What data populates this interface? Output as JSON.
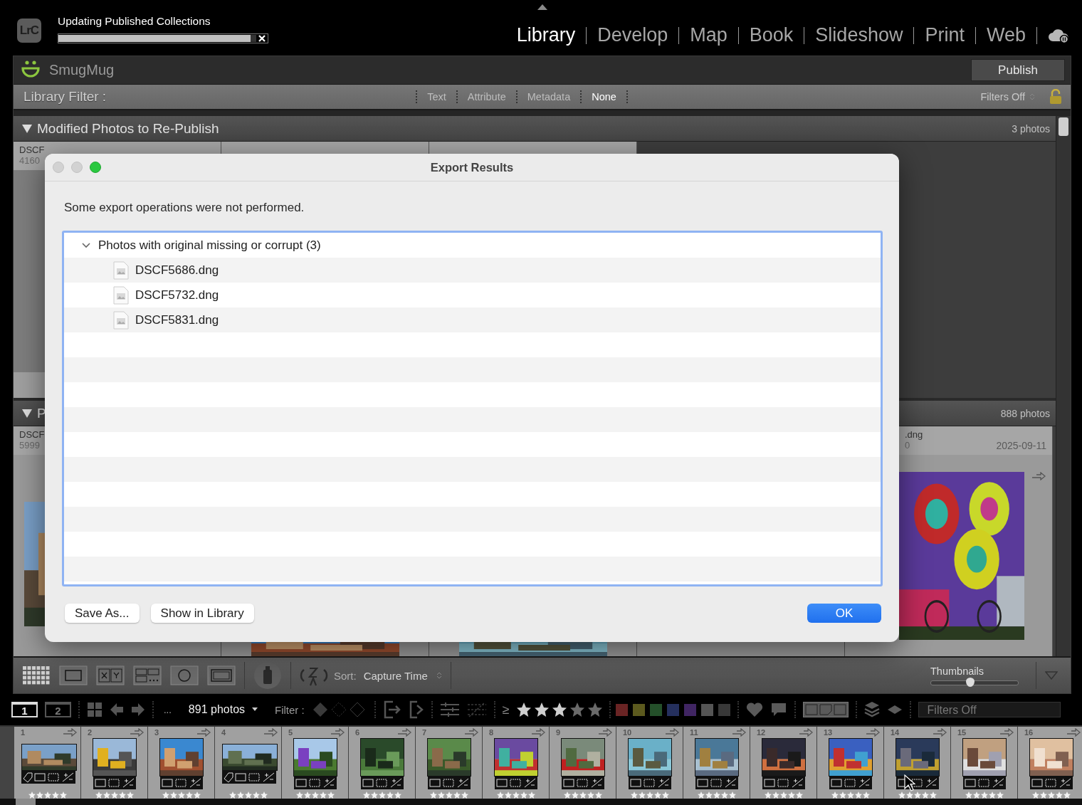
{
  "top_bar": {
    "logo": "LrC",
    "task": {
      "title": "Updating Published Collections",
      "level": 0.97
    },
    "modules": [
      {
        "label": "Library",
        "selected": true
      },
      {
        "label": "Develop",
        "selected": false
      },
      {
        "label": "Map",
        "selected": false
      },
      {
        "label": "Book",
        "selected": false
      },
      {
        "label": "Slideshow",
        "selected": false
      },
      {
        "label": "Print",
        "selected": false
      },
      {
        "label": "Web",
        "selected": false
      }
    ]
  },
  "publish_header": {
    "service": "SmugMug",
    "button": "Publish"
  },
  "library_filter": {
    "label": "Library Filter :",
    "preset": "Filters Off",
    "options": [
      {
        "label": "Text",
        "selected": false
      },
      {
        "label": "Attribute",
        "selected": false
      },
      {
        "label": "Metadata",
        "selected": false
      },
      {
        "label": "None",
        "selected": true
      }
    ]
  },
  "sections": [
    {
      "title": "Modified Photos to Re-Publish",
      "count": "3 photos",
      "cells": [
        {
          "name": "DSCF",
          "detail": "4160"
        }
      ]
    },
    {
      "title": "P",
      "count": "888 photos",
      "cells": [
        {
          "name": "DSCF",
          "detail": "5999"
        },
        {
          "name": ".dng",
          "detail": "0",
          "date": "2025-09-11"
        }
      ]
    }
  ],
  "toolbar": {
    "sort_label": "Sort:",
    "sort_value": "Capture Time",
    "thumbnails": {
      "label": "Thumbnails",
      "level": 0.45
    }
  },
  "filmstrip_bar": {
    "screens": [
      {
        "label": "1",
        "selected": true
      },
      {
        "label": "2",
        "selected": false
      }
    ],
    "breadcrumb": "...",
    "count": "891 photos",
    "filter_label": "Filter :",
    "rating": {
      "operator": "≥",
      "stars": 3
    },
    "color_labels": [
      {
        "color": "#6a2424"
      },
      {
        "color": "#5c5a1e"
      },
      {
        "color": "#24502a"
      },
      {
        "color": "#25305e"
      },
      {
        "color": "#402563"
      },
      {
        "color": "#555555"
      },
      {
        "color": "#383838"
      }
    ],
    "preset": "Filters Off"
  },
  "filmstrip": [
    {
      "number": "1",
      "kind": "landscape",
      "stars": 5
    },
    {
      "number": "2",
      "kind": "portrait",
      "stars": 5
    },
    {
      "number": "3",
      "kind": "portrait",
      "stars": 5
    },
    {
      "number": "4",
      "kind": "landscape",
      "stars": 5
    },
    {
      "number": "5",
      "kind": "portrait",
      "stars": 5
    },
    {
      "number": "6",
      "kind": "portrait",
      "stars": 5
    },
    {
      "number": "7",
      "kind": "portrait",
      "stars": 5
    },
    {
      "number": "8",
      "kind": "portrait",
      "stars": 5
    },
    {
      "number": "9",
      "kind": "portrait",
      "stars": 5
    },
    {
      "number": "10",
      "kind": "portrait",
      "stars": 5
    },
    {
      "number": "11",
      "kind": "portrait",
      "stars": 5
    },
    {
      "number": "12",
      "kind": "portrait",
      "stars": 5
    },
    {
      "number": "13",
      "kind": "portrait",
      "stars": 5
    },
    {
      "number": "14",
      "kind": "portrait",
      "stars": 5
    },
    {
      "number": "15",
      "kind": "portrait",
      "stars": 5
    },
    {
      "number": "16",
      "kind": "portrait",
      "stars": 5
    }
  ],
  "dialog": {
    "title": "Export Results",
    "message": "Some export operations were not performed.",
    "groups": [
      {
        "label": "Photos with original missing or corrupt (3)",
        "expanded": true,
        "children": [
          {
            "label": "DSCF5686.dng"
          },
          {
            "label": "DSCF5732.dng"
          },
          {
            "label": "DSCF5831.dng"
          }
        ]
      }
    ],
    "buttons": [
      {
        "label": "Save As...",
        "kind": "secondary"
      },
      {
        "label": "Show in Library",
        "kind": "secondary"
      },
      {
        "label": "OK",
        "kind": "default"
      }
    ]
  }
}
